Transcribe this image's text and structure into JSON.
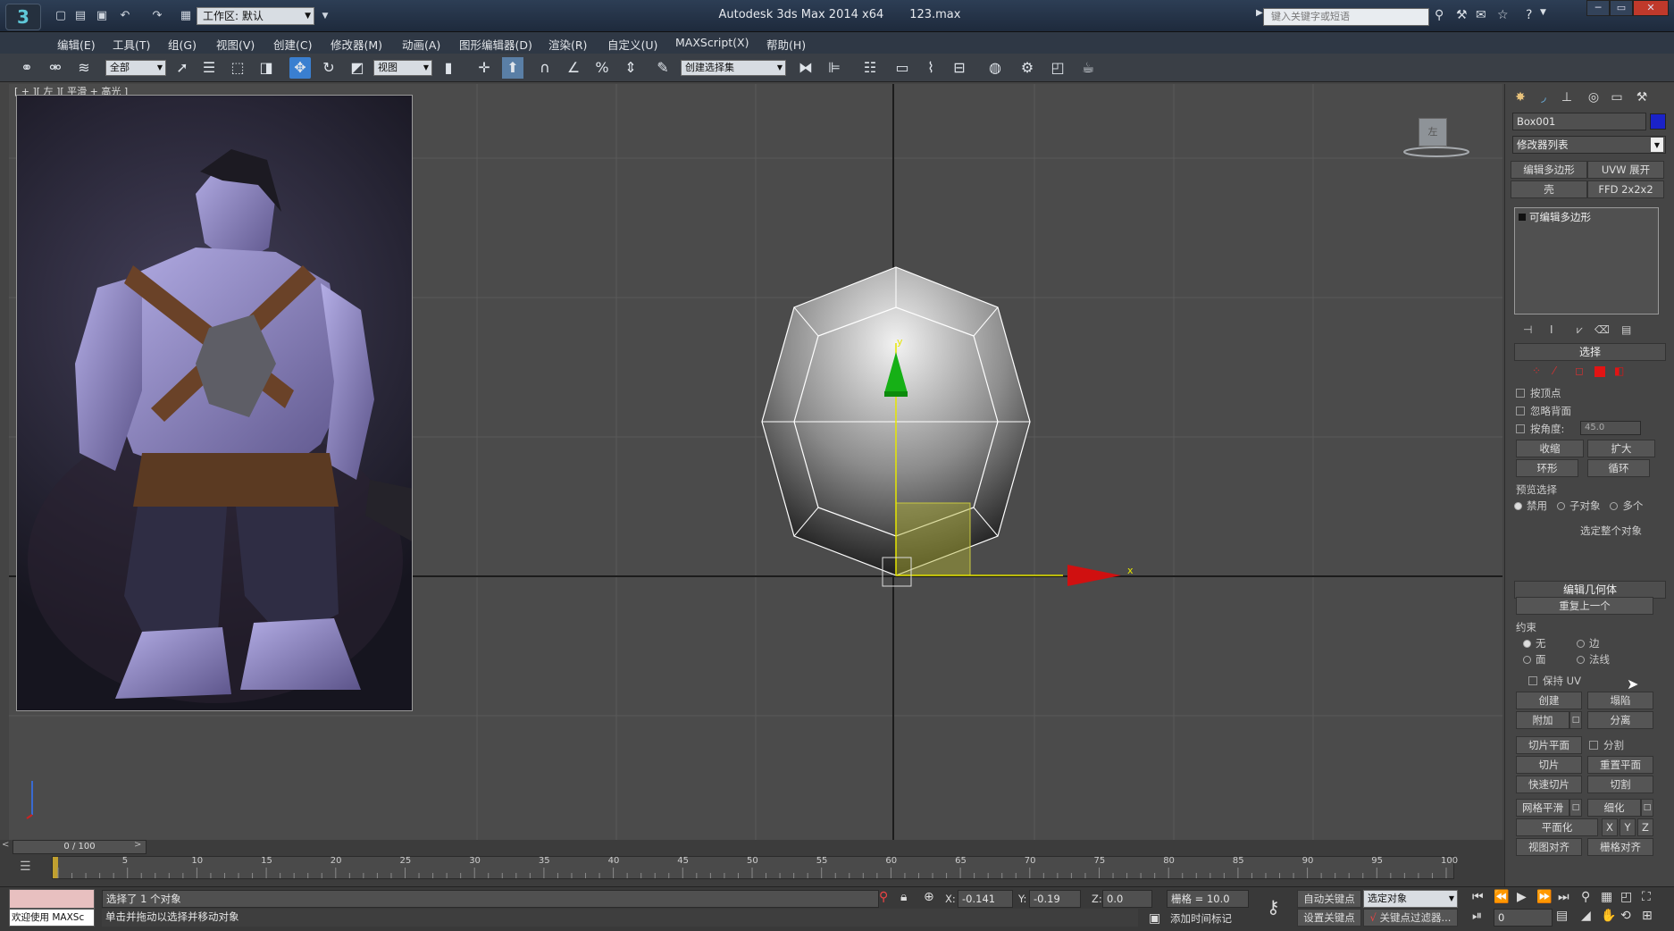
{
  "app": {
    "title": "Autodesk 3ds Max  2014 x64",
    "file": "123.max",
    "workspace": "工作区: 默认",
    "search_placeholder": "键入关键字或短语"
  },
  "menu": [
    "编辑(E)",
    "工具(T)",
    "组(G)",
    "视图(V)",
    "创建(C)",
    "修改器(M)",
    "动画(A)",
    "图形编辑器(D)",
    "渲染(R)",
    "自定义(U)",
    "MAXScript(X)",
    "帮助(H)"
  ],
  "toolbar": {
    "filter": "全部",
    "ref_coord": "视图",
    "selection_set": "创建选择集"
  },
  "viewport": {
    "label": "[ + ][ 左 ][ 平滑 + 高光 ]",
    "axis_x": "x",
    "axis_y": "y",
    "viewcube_label": "左"
  },
  "cmdpanel": {
    "object_name": "Box001",
    "object_color": "#1a22c8",
    "modifier_list": "修改器列表",
    "mod_buttons": [
      "编辑多边形",
      "UVW 展开",
      "壳",
      "FFD 2x2x2"
    ],
    "stack_item": "可编辑多边形",
    "selection": {
      "title": "选择",
      "by_vertex": "按顶点",
      "ignore_backface": "忽略背面",
      "by_angle": "按角度:",
      "angle_value": "45.0",
      "shrink": "收缩",
      "grow": "扩大",
      "ring": "环形",
      "loop": "循环",
      "preview_title": "预览选择",
      "preview_off": "禁用",
      "preview_subobj": "子对象",
      "preview_multi": "多个",
      "select_whole": "选定整个对象"
    },
    "edit_geometry": {
      "title": "编辑几何体",
      "repeat_last": "重复上一个",
      "constraint_title": "约束",
      "c_none": "无",
      "c_edge": "边",
      "c_face": "面",
      "c_normal": "法线",
      "preserve_uv": "保持 UV",
      "create": "创建",
      "collapse": "塌陷",
      "attach": "附加",
      "detach": "分离",
      "slice_plane": "切片平面",
      "split": "分割",
      "slice": "切片",
      "reset_plane": "重置平面",
      "quickslice": "快速切片",
      "cut": "切割",
      "meshsmooth": "网格平滑",
      "tessellate": "细化",
      "make_planar": "平面化",
      "x": "X",
      "y": "Y",
      "z": "Z",
      "view_align": "视图对齐",
      "grid_align": "栅格对齐"
    }
  },
  "timeline": {
    "slider": "0 / 100",
    "ticks": [
      "5",
      "10",
      "15",
      "20",
      "25",
      "30",
      "35",
      "40",
      "45",
      "50",
      "55",
      "60",
      "65",
      "70",
      "75",
      "80",
      "85",
      "90",
      "95",
      "100"
    ]
  },
  "status": {
    "welcome": "欢迎使用 MAXSc",
    "selected": "选择了 1 个对象",
    "hint": "单击并拖动以选择并移动对象",
    "x_label": "X:",
    "x_value": "-0.141",
    "y_label": "Y:",
    "y_value": "-0.19",
    "z_label": "Z:",
    "z_value": "0.0",
    "grid": "栅格 = 10.0",
    "auto_key": "自动关键点",
    "selected_obj": "选定对象",
    "set_key": "设置关键点",
    "key_filters": "关键点过滤器...",
    "add_tag": "添加时间标记",
    "frame": "0"
  }
}
